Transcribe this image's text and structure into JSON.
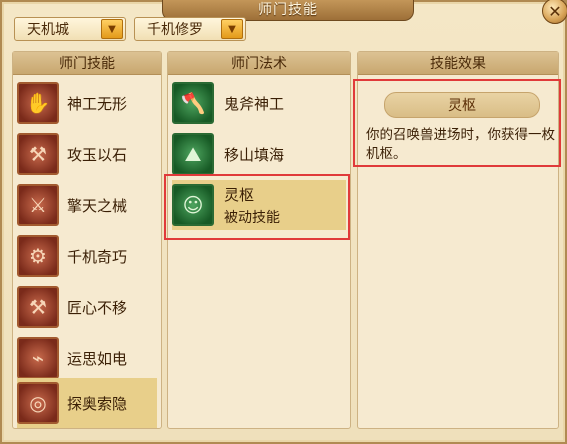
{
  "window": {
    "title": "师门技能",
    "close_symbol": "✕"
  },
  "dropdowns": [
    {
      "label": "天机城",
      "arrow": "▼"
    },
    {
      "label": "千机修罗",
      "arrow": "▼"
    }
  ],
  "left_panel": {
    "header": "师门技能",
    "items": [
      {
        "label": "神工无形",
        "icon": "hand-icon"
      },
      {
        "label": "攻玉以石",
        "icon": "tools-icon"
      },
      {
        "label": "擎天之械",
        "icon": "spear-icon"
      },
      {
        "label": "千机奇巧",
        "icon": "gear-icon"
      },
      {
        "label": "匠心不移",
        "icon": "hammer-icon"
      },
      {
        "label": "运思如电",
        "icon": "lightning-icon"
      },
      {
        "label": "探奥索隐",
        "icon": "spiral-icon",
        "selected": true
      }
    ]
  },
  "mid_panel": {
    "header": "师门法术",
    "items": [
      {
        "label": "鬼斧神工",
        "icon": "axe-icon"
      },
      {
        "label": "移山填海",
        "icon": "mountain-icon"
      },
      {
        "label": "灵枢",
        "sub": "被动技能",
        "icon": "pet-icon",
        "selected": true
      }
    ]
  },
  "right_panel": {
    "header": "技能效果",
    "effect_title": "灵枢",
    "effect_desc": "你的召唤兽进场时，你获得一枚机枢。"
  },
  "colors": {
    "highlight": "#e03a3a",
    "selected_bg": "#e8cf8a"
  }
}
